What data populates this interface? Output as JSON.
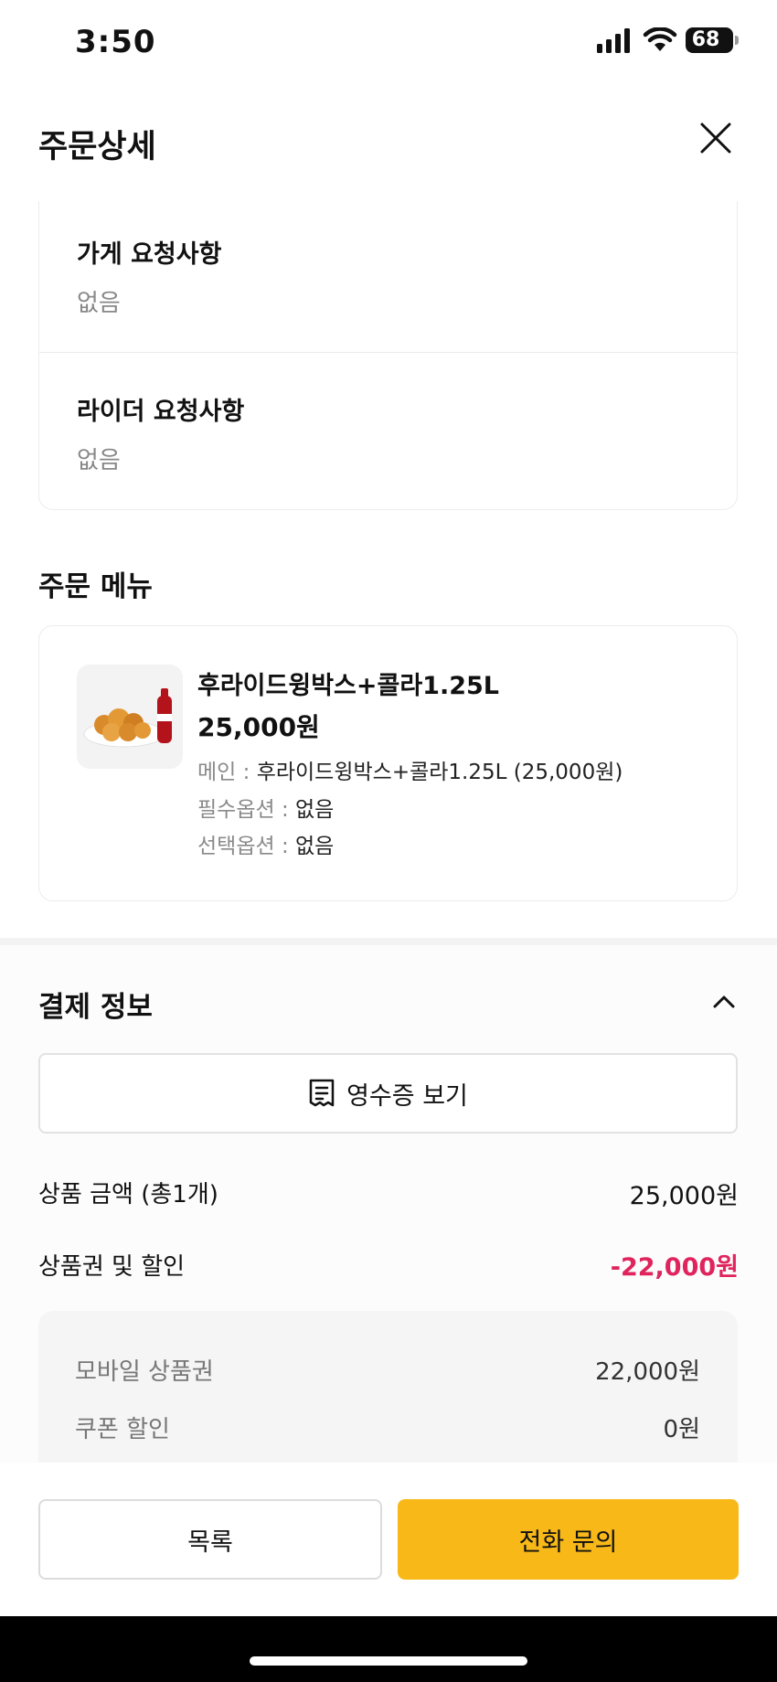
{
  "status_bar": {
    "time": "3:50",
    "battery": "68"
  },
  "header": {
    "title": "주문상세"
  },
  "requests": {
    "store": {
      "title": "가게 요청사항",
      "value": "없음"
    },
    "rider": {
      "title": "라이더 요청사항",
      "value": "없음"
    }
  },
  "order_menu": {
    "title": "주문 메뉴",
    "item": {
      "name": "후라이드윙박스+콜라1.25L",
      "price": "25,000원",
      "options": [
        {
          "label": "메인 : ",
          "value": "후라이드윙박스+콜라1.25L (25,000원)"
        },
        {
          "label": "필수옵션 : ",
          "value": "없음"
        },
        {
          "label": "선택옵션 : ",
          "value": "없음"
        }
      ]
    }
  },
  "payment": {
    "title": "결제 정보",
    "receipt_button": "영수증 보기",
    "rows": [
      {
        "label": "상품 금액 (총1개)",
        "value": "25,000원"
      },
      {
        "label": "상품권 및 할인",
        "value": "-22,000원"
      }
    ],
    "breakdown": [
      {
        "label": "모바일 상품권",
        "value": "22,000원"
      },
      {
        "label": "쿠폰 할인",
        "value": "0원"
      }
    ]
  },
  "buttons": {
    "list": "목록",
    "call": "전화 문의"
  },
  "colors": {
    "accent": "#f8b918",
    "discount": "#e0245e"
  }
}
